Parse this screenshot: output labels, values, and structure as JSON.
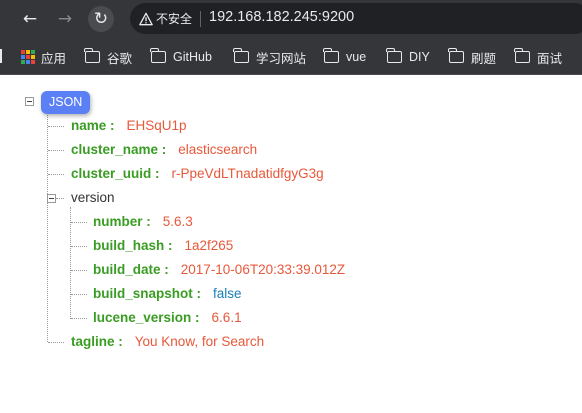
{
  "browser": {
    "back_icon": "←",
    "forward_icon": "→",
    "reload_icon": "↻",
    "security_label": "不安全",
    "url": "192.168.182.245:9200"
  },
  "bookmarks": [
    {
      "label": "应用",
      "icon": "apps-grid-icon"
    },
    {
      "label": "谷歌",
      "icon": "folder-icon"
    },
    {
      "label": "GitHub",
      "icon": "folder-icon"
    },
    {
      "label": "学习网站",
      "icon": "folder-icon"
    },
    {
      "label": "vue",
      "icon": "folder-icon"
    },
    {
      "label": "DIY",
      "icon": "folder-icon"
    },
    {
      "label": "刷题",
      "icon": "folder-icon"
    },
    {
      "label": "面试",
      "icon": "folder-icon"
    }
  ],
  "json_viewer": {
    "root_label": "JSON",
    "fields": {
      "name": {
        "key": "name :",
        "value": "EHSqU1p"
      },
      "cluster_name": {
        "key": "cluster_name :",
        "value": "elasticsearch"
      },
      "cluster_uuid": {
        "key": "cluster_uuid :",
        "value": "r-PpeVdLTnadatidfgyG3g"
      },
      "version": {
        "key": "version",
        "number": {
          "key": "number :",
          "value": "5.6.3"
        },
        "build_hash": {
          "key": "build_hash :",
          "value": "1a2f265"
        },
        "build_date": {
          "key": "build_date :",
          "value": "2017-10-06T20:33:39.012Z"
        },
        "build_snapshot": {
          "key": "build_snapshot :",
          "value": "false"
        },
        "lucene_version": {
          "key": "lucene_version :",
          "value": "6.6.1"
        }
      },
      "tagline": {
        "key": "tagline :",
        "value": "You Know, for Search"
      }
    }
  },
  "colors": {
    "chrome_bg": "#35363a",
    "omnibox_bg": "#202124",
    "key_green": "#3a9d23",
    "string_orange": "#e8583a",
    "boolean_blue": "#1a7fb8",
    "badge_blue": "#5b7ff5"
  }
}
